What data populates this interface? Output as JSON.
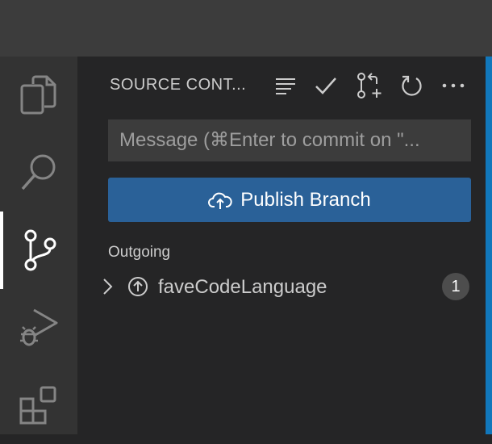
{
  "activity_bar": {
    "items": [
      {
        "icon": "files-icon",
        "active": false
      },
      {
        "icon": "search-icon",
        "active": false
      },
      {
        "icon": "source-control-icon",
        "active": true
      },
      {
        "icon": "run-debug-icon",
        "active": false
      },
      {
        "icon": "extensions-icon",
        "active": false
      }
    ]
  },
  "sidebar": {
    "title": "SOURCE CONT...",
    "actions": [
      "list-icon",
      "check-icon",
      "pull-request-icon",
      "refresh-icon",
      "more-icon"
    ],
    "commit_input": {
      "value": "",
      "placeholder": "Message (⌘Enter to commit on \"..."
    },
    "publish_button": {
      "label": "Publish Branch",
      "icon": "cloud-upload-icon"
    },
    "outgoing": {
      "label": "Outgoing",
      "items": [
        {
          "name": "faveCodeLanguage",
          "count": "1",
          "icon": "arrow-up-circle-icon"
        }
      ]
    }
  },
  "colors": {
    "accent": "#1177bb",
    "button": "#2a6198",
    "activity_bar": "#333333",
    "sidebar": "#252526",
    "title_bar": "#3c3c3c"
  }
}
